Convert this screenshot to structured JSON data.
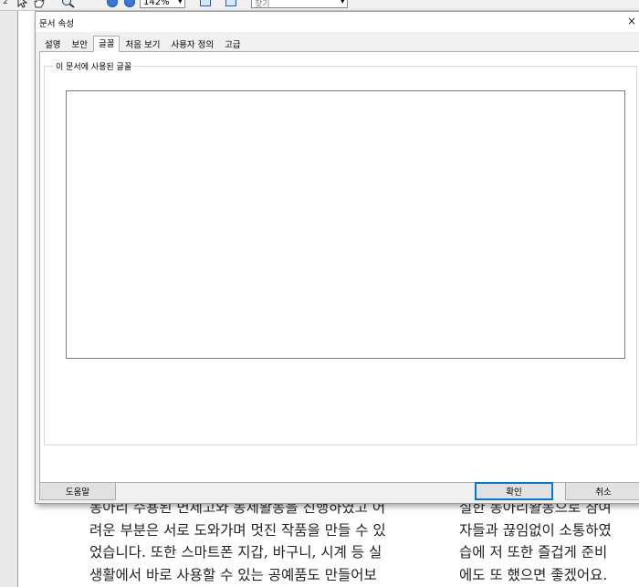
{
  "toolbar": {
    "page_number": "2",
    "zoom_value": "142%",
    "find_placeholder": "찾기"
  },
  "document": {
    "column1": [
      "동아리 수용된 면제고와 동제활동을 진행하였고 어",
      "려운 부분은 서로 도와가며 멋진 작품을 만들 수 있",
      "었습니다. 또한 스마트폰 지갑, 바구니, 시계 등 실",
      "생활에서 바로 사용할 수 있는 공예품도 만들어보"
    ],
    "column2": [
      "실한 동아리활동으로 참여",
      "자들과 끊임없이 소통하였",
      "습에 저 또한 즐겁게 준비",
      "에도 또 했으면 좋겠어요."
    ]
  },
  "dialog": {
    "title": "문서 속성",
    "close_glyph": "×",
    "tabs": [
      {
        "label": "설명"
      },
      {
        "label": "보안"
      },
      {
        "label": "글꼴"
      },
      {
        "label": "처음 보기"
      },
      {
        "label": "사용자 정의"
      },
      {
        "label": "고급"
      }
    ],
    "active_tab": "글꼴",
    "group_label": "이 문서에 사용된 글꼴",
    "buttons": {
      "help": "도움말",
      "ok": "확인",
      "cancel": "취소"
    }
  },
  "colors": {
    "dialog_bg": "#f0f0f0",
    "accent": "#0078d7"
  },
  "icons": [
    "select-cursor-icon",
    "hand-tool-icon",
    "zoom-tool-icon",
    "zoom-out-icon",
    "zoom-in-icon",
    "fit-page-icon",
    "fit-width-icon",
    "dropdown-arrow-icon",
    "close-icon"
  ]
}
